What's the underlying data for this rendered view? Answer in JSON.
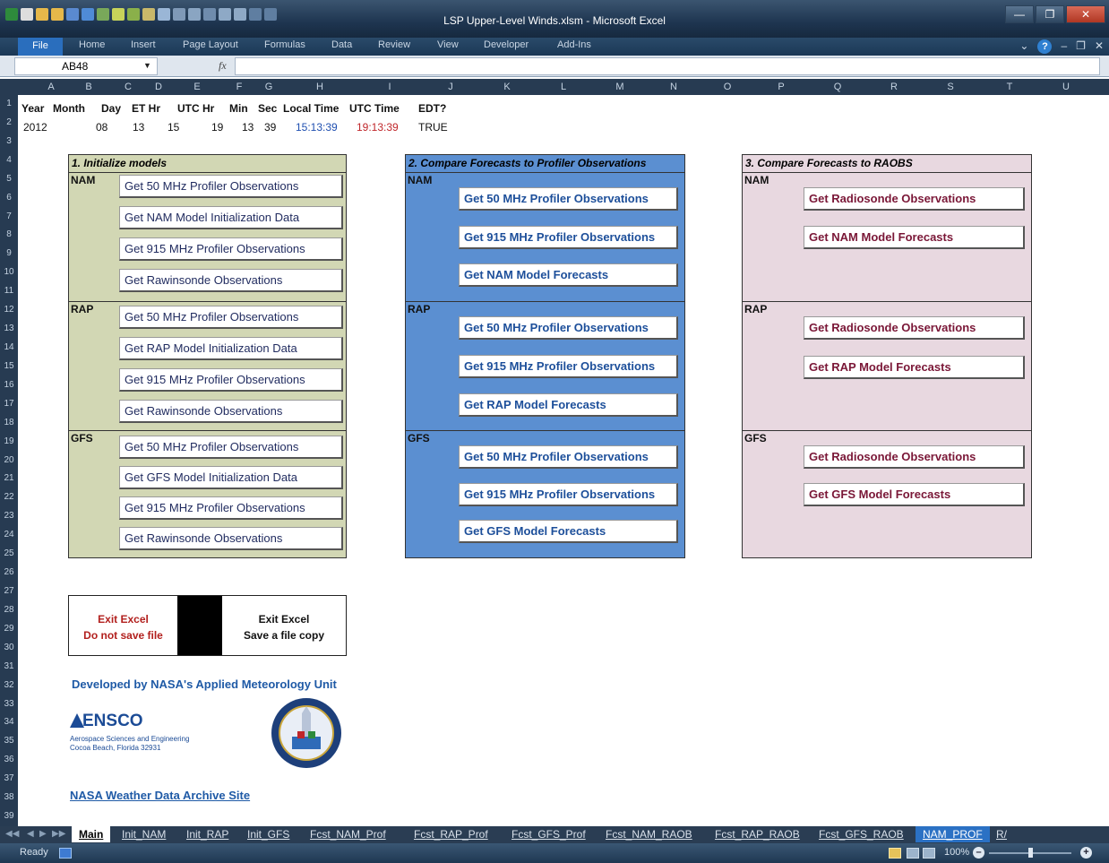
{
  "window": {
    "title": "LSP Upper-Level Winds.xlsm - Microsoft Excel"
  },
  "ribbon": {
    "file": "File",
    "tabs": [
      "Home",
      "Insert",
      "Page Layout",
      "Formulas",
      "Data",
      "Review",
      "View",
      "Developer",
      "Add-Ins"
    ]
  },
  "formula_bar": {
    "name_box": "AB48",
    "fx": "fx",
    "value": ""
  },
  "grid": {
    "columns": [
      "A",
      "B",
      "C",
      "D",
      "E",
      "F",
      "G",
      "H",
      "I",
      "J",
      "K",
      "L",
      "M",
      "N",
      "O",
      "P",
      "Q",
      "R",
      "S",
      "T",
      "U"
    ],
    "rows": [
      "1",
      "2",
      "3",
      "4",
      "5",
      "6",
      "7",
      "8",
      "9",
      "10",
      "11",
      "12",
      "13",
      "14",
      "15",
      "16",
      "17",
      "18",
      "19",
      "20",
      "21",
      "22",
      "23",
      "24",
      "25",
      "26",
      "27",
      "28",
      "29",
      "30",
      "31",
      "32",
      "33",
      "34",
      "35",
      "36",
      "37",
      "38",
      "39"
    ]
  },
  "time_table": {
    "headers": [
      "Year",
      "Month",
      "Day",
      "ET Hr",
      "UTC Hr",
      "Min",
      "Sec",
      "Local Time",
      "UTC Time",
      "EDT?"
    ],
    "values": [
      "2012",
      "08",
      "13",
      "15",
      "19",
      "13",
      "39",
      "15:13:39",
      "19:13:39",
      "TRUE"
    ],
    "local_time_color": "#1f4fb0",
    "utc_time_color": "#c0262a"
  },
  "panels": {
    "init": {
      "title": "1. Initialize models",
      "sections": [
        {
          "label": "NAM",
          "buttons": [
            "Get 50 MHz Profiler Observations",
            "Get NAM Model Initialization Data",
            "Get 915 MHz Profiler Observations",
            "Get Rawinsonde Observations"
          ]
        },
        {
          "label": "RAP",
          "buttons": [
            "Get 50 MHz Profiler Observations",
            "Get RAP Model Initialization Data",
            "Get 915 MHz Profiler Observations",
            "Get Rawinsonde Observations"
          ]
        },
        {
          "label": "GFS",
          "buttons": [
            "Get 50 MHz Profiler Observations",
            "Get GFS Model Initialization Data",
            "Get 915 MHz Profiler Observations",
            "Get Rawinsonde Observations"
          ]
        }
      ]
    },
    "profiler": {
      "title": "2. Compare Forecasts to Profiler Observations",
      "sections": [
        {
          "label": "NAM",
          "buttons": [
            "Get 50 MHz Profiler Observations",
            "Get 915 MHz Profiler Observations",
            "Get NAM Model Forecasts"
          ]
        },
        {
          "label": "RAP",
          "buttons": [
            "Get 50 MHz Profiler Observations",
            "Get 915 MHz Profiler Observations",
            "Get RAP Model Forecasts"
          ]
        },
        {
          "label": "GFS",
          "buttons": [
            "Get 50 MHz Profiler Observations",
            "Get 915 MHz Profiler Observations",
            "Get GFS Model Forecasts"
          ]
        }
      ]
    },
    "raobs": {
      "title": "3. Compare Forecasts to RAOBS",
      "sections": [
        {
          "label": "NAM",
          "buttons": [
            "Get Radiosonde Observations",
            "Get NAM Model Forecasts"
          ]
        },
        {
          "label": "RAP",
          "buttons": [
            "Get Radiosonde Observations",
            "Get RAP Model Forecasts"
          ]
        },
        {
          "label": "GFS",
          "buttons": [
            "Get Radiosonde Observations",
            "Get GFS Model Forecasts"
          ]
        }
      ]
    }
  },
  "exit": {
    "nosave_line1": "Exit Excel",
    "nosave_line2": "Do not save file",
    "save_line1": "Exit Excel",
    "save_line2": "Save a file copy"
  },
  "credits": {
    "developed_by": "Developed by NASA's Applied Meteorology Unit",
    "ensco_name": "ENSCO",
    "ensco_line1": "Aerospace Sciences and Engineering",
    "ensco_line2": "Cocoa Beach, Florida 32931",
    "archive_link": "NASA Weather Data Archive Site"
  },
  "sheet_tabs": [
    "Main",
    "Init_NAM",
    "Init_RAP",
    "Init_GFS",
    "Fcst_NAM_Prof",
    "Fcst_RAP_Prof",
    "Fcst_GFS_Prof",
    "Fcst_NAM_RAOB",
    "Fcst_RAP_RAOB",
    "Fcst_GFS_RAOB",
    "NAM_PROF",
    "R/"
  ],
  "status": {
    "ready": "Ready",
    "zoom": "100%"
  },
  "colors": {
    "panel_init": "#d2d7b4",
    "panel_profiler": "#5b8fd1",
    "panel_raobs": "#e8d8e0"
  }
}
